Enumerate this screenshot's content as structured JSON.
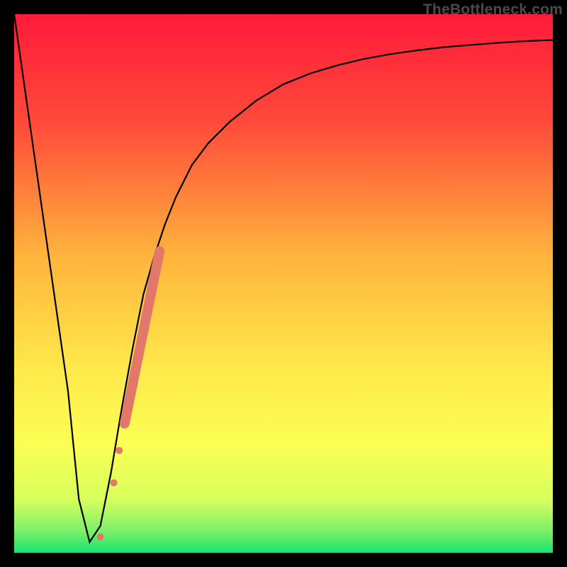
{
  "watermark": "TheBottleneck.com",
  "chart_data": {
    "type": "line",
    "xlim": [
      0,
      100
    ],
    "ylim": [
      0,
      100
    ],
    "title": "",
    "xlabel": "",
    "ylabel": "",
    "series": [
      {
        "name": "curve",
        "x": [
          0,
          5,
          10,
          12,
          14,
          16,
          18,
          20,
          22,
          24,
          26,
          28,
          30,
          33,
          36,
          40,
          45,
          50,
          55,
          60,
          65,
          70,
          75,
          80,
          85,
          90,
          95,
          100
        ],
        "y": [
          100,
          65,
          30,
          10,
          2,
          5,
          15,
          27,
          38,
          48,
          55,
          61,
          66,
          72,
          76,
          80,
          84,
          87,
          89,
          90.5,
          91.7,
          92.6,
          93.3,
          93.9,
          94.3,
          94.7,
          95.0,
          95.2
        ]
      }
    ],
    "markers": [
      {
        "x": 16.0,
        "y": 3.0,
        "r": 5
      },
      {
        "x": 18.5,
        "y": 13.0,
        "r": 5
      },
      {
        "x": 19.5,
        "y": 19.0,
        "r": 5
      }
    ],
    "thick_segment": {
      "x0": 20.5,
      "y0": 24.0,
      "x1": 27.0,
      "y1": 56.0,
      "width": 14
    },
    "marker_color": "#e2786a",
    "gradient_stops": [
      {
        "offset": 0.0,
        "color": "#ff1a3a"
      },
      {
        "offset": 0.2,
        "color": "#ff4a3a"
      },
      {
        "offset": 0.45,
        "color": "#ffb43c"
      },
      {
        "offset": 0.65,
        "color": "#ffe74a"
      },
      {
        "offset": 0.8,
        "color": "#fbff54"
      },
      {
        "offset": 0.9,
        "color": "#d7ff5c"
      },
      {
        "offset": 0.96,
        "color": "#7cf06a"
      },
      {
        "offset": 1.0,
        "color": "#19e36e"
      }
    ]
  }
}
